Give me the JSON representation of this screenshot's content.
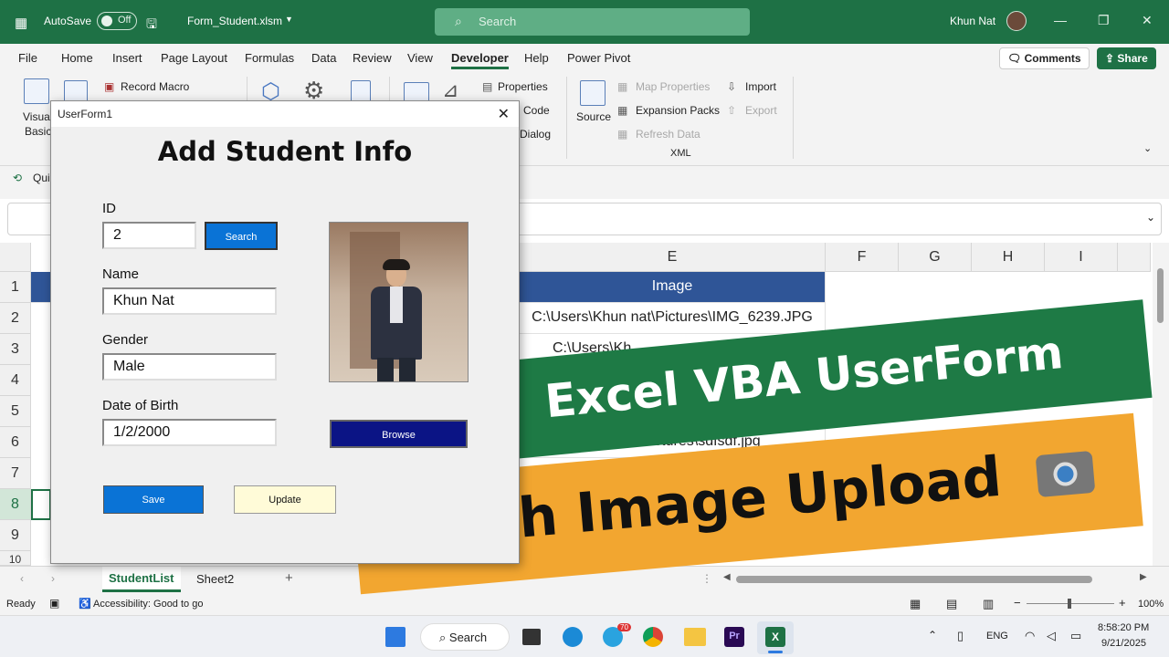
{
  "titlebar": {
    "autosave_label": "AutoSave",
    "autosave_state": "Off",
    "filename": "Form_Student.xlsm",
    "search_placeholder": "Search",
    "user_name": "Khun Nat",
    "bg_color": "#1e7145"
  },
  "tabs": [
    "File",
    "Home",
    "Insert",
    "Page Layout",
    "Formulas",
    "Data",
    "Review",
    "View",
    "Developer",
    "Help",
    "Power Pivot"
  ],
  "active_tab": "Developer",
  "comments_label": "Comments",
  "share_label": "Share",
  "ribbon": {
    "visual_basic_1": "Visual",
    "visual_basic_2": "Basic",
    "record_macro": "Record Macro",
    "properties": "Properties",
    "code": "Code",
    "dialog": "Dialog",
    "source": "Source",
    "map_properties": "Map Properties",
    "expansion_packs": "Expansion Packs",
    "refresh_data": "Refresh Data",
    "import": "Import",
    "export": "Export",
    "xml_group": "XML",
    "quick_partial": "Qui"
  },
  "columns": [
    "E",
    "F",
    "G",
    "H",
    "I"
  ],
  "rows": [
    "1",
    "2",
    "3",
    "4",
    "5",
    "6",
    "7",
    "8",
    "9",
    "10"
  ],
  "cells": {
    "e1": "Image",
    "e2": "C:\\Users\\Khun nat\\Pictures\\IMG_6239.JPG",
    "e3": "C:\\Users\\Kh",
    "e6": "\\Khun nat\\Pictures\\sdfsdf.jpg"
  },
  "sheets": [
    "StudentList",
    "Sheet2"
  ],
  "active_sheet": "StudentList",
  "status": {
    "ready": "Ready",
    "accessibility": "Accessibility: Good to go",
    "zoom": "100%"
  },
  "taskbar": {
    "search_label": "Search",
    "lang": "ENG",
    "time": "8:58:20 PM",
    "date": "9/21/2025",
    "telegram_badge": "70"
  },
  "userform": {
    "title": "UserForm1",
    "heading": "Add Student Info",
    "id_label": "ID",
    "id_value": "2",
    "search_button": "Search",
    "name_label": "Name",
    "name_value": "Khun Nat",
    "gender_label": "Gender",
    "gender_value": "Male",
    "dob_label": "Date of Birth",
    "dob_value": "1/2/2000",
    "browse_button": "Browse",
    "save_button": "Save",
    "update_button": "Update"
  },
  "banners": {
    "line1": "Excel VBA UserForm",
    "line2": "With Image Upload",
    "line1_bg": "#1e7a45",
    "line2_bg": "#f2a630"
  }
}
